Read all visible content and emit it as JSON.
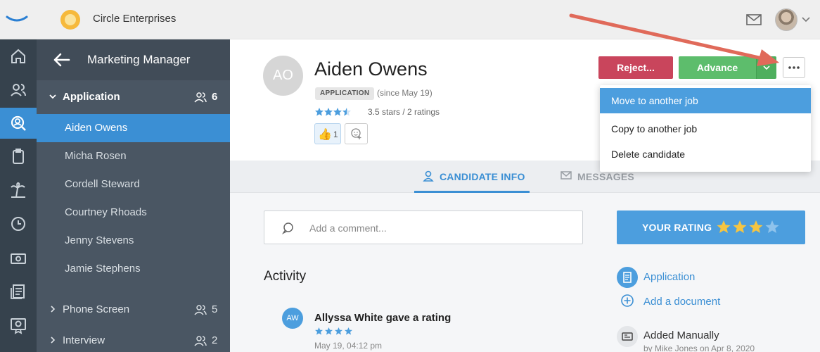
{
  "topbar": {
    "company_name": "Circle Enterprises",
    "icons": [
      "app-logo-icon",
      "company-logo-icon",
      "mail-icon",
      "user-avatar",
      "chevron-down-icon"
    ]
  },
  "rail": {
    "items": [
      "home-icon",
      "people-icon",
      "search-candidates-icon",
      "clipboard-icon",
      "vacation-icon",
      "clock-icon",
      "money-icon",
      "reports-icon",
      "badge-icon"
    ],
    "active": "search-candidates-icon"
  },
  "sidebar": {
    "job_title": "Marketing Manager",
    "stages": [
      {
        "label": "Application",
        "count": "6"
      },
      {
        "label": "Phone Screen",
        "count": "5"
      },
      {
        "label": "Interview",
        "count": "2"
      }
    ],
    "candidates": [
      "Aiden Owens",
      "Micha Rosen",
      "Cordell Steward",
      "Courtney Rhoads",
      "Jenny Stevens",
      "Jamie Stephens"
    ]
  },
  "candidate": {
    "initials": "AO",
    "name": "Aiden Owens",
    "stage_badge": "APPLICATION",
    "since": "(since May 19)",
    "rating_text": "3.5 stars / 2 ratings",
    "rating_value": 3.5,
    "reaction_count": "1"
  },
  "actions": {
    "reject": "Reject...",
    "advance": "Advance",
    "menu": [
      "Move to another job",
      "Copy to another job",
      "Delete candidate"
    ],
    "selected_menu_item": "Move to another job"
  },
  "tabs": [
    "CANDIDATE INFO",
    "MESSAGES"
  ],
  "comment": {
    "placeholder": "Add a comment..."
  },
  "your_rating": {
    "label": "YOUR RATING",
    "value": 3,
    "max": 4
  },
  "activity": {
    "title": "Activity",
    "item": {
      "initials": "AW",
      "title": "Allyssa White gave a rating",
      "stars": 4,
      "time": "May 19, 04:12 pm"
    }
  },
  "side": {
    "application": "Application",
    "add_document": "Add a document",
    "added": "Added Manually",
    "added_by": "by Mike Jones on Apr 8, 2020"
  },
  "colors": {
    "accent": "#3b8fd4",
    "reject": "#c9455c",
    "advance": "#5dbd6c",
    "sidebar": "#4a5663",
    "rail": "#36424d",
    "star": "#f5c542",
    "annotation_arrow": "#e06a5a"
  }
}
